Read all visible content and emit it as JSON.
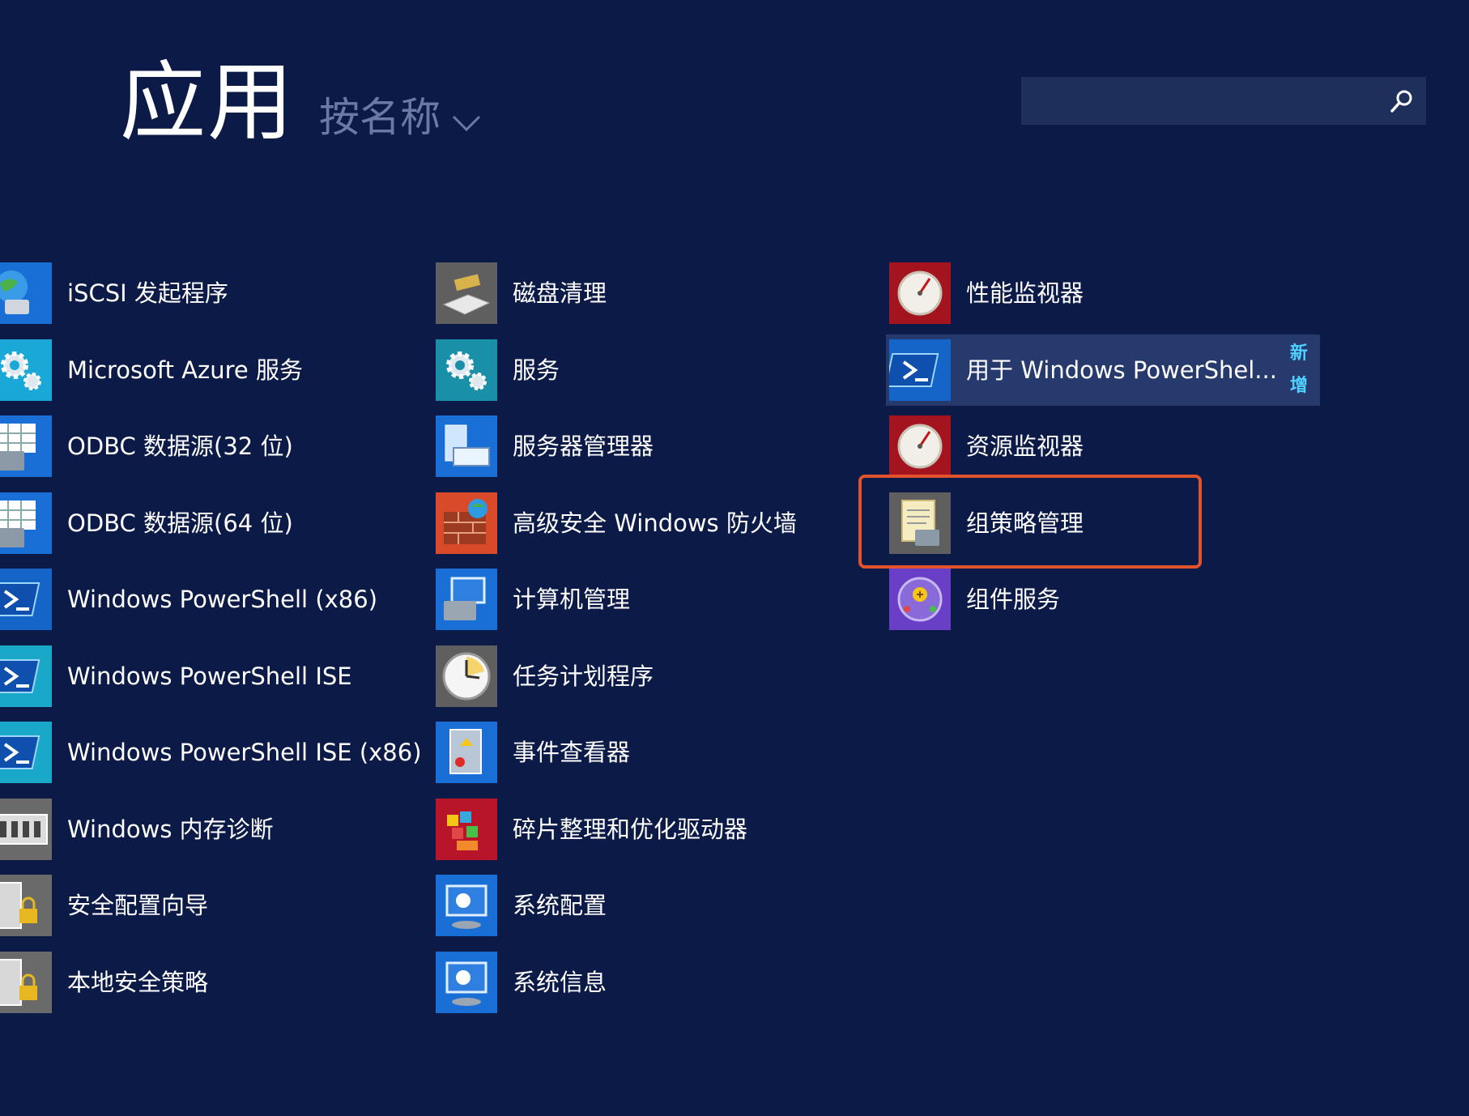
{
  "header": {
    "title": "应用",
    "sort_label": "按名称"
  },
  "search": {
    "value": "",
    "placeholder": ""
  },
  "columns": [
    {
      "items": [
        {
          "label": "iSCSI 发起程序",
          "icon": "iscsi-globe-icon",
          "color": "#1a6fd6"
        },
        {
          "label": "Microsoft Azure 服务",
          "icon": "azure-cloud-gear-icon",
          "color": "#1aa8d8"
        },
        {
          "label": "ODBC 数据源(32 位)",
          "icon": "odbc-table-toolbox-icon",
          "color": "#1a6fd6"
        },
        {
          "label": "ODBC 数据源(64 位)",
          "icon": "odbc-table-toolbox-icon",
          "color": "#1a6fd6"
        },
        {
          "label": "Windows PowerShell (x86)",
          "icon": "powershell-icon",
          "color": "#1565c8"
        },
        {
          "label": "Windows PowerShell ISE",
          "icon": "powershell-ise-icon",
          "color": "#1aa8c8"
        },
        {
          "label": "Windows PowerShell ISE (x86)",
          "icon": "powershell-ise-icon",
          "color": "#1aa8c8"
        },
        {
          "label": "Windows 内存诊断",
          "icon": "memory-chip-icon",
          "color": "#6a6a6a"
        },
        {
          "label": "安全配置向导",
          "icon": "server-lock-icon",
          "color": "#6a6a6a"
        },
        {
          "label": "本地安全策略",
          "icon": "server-lock-icon",
          "color": "#6a6a6a"
        }
      ]
    },
    {
      "items": [
        {
          "label": "磁盘清理",
          "icon": "disk-cleanup-icon",
          "color": "#5f5f5f"
        },
        {
          "label": "服务",
          "icon": "services-gears-icon",
          "color": "#1a8fa8"
        },
        {
          "label": "服务器管理器",
          "icon": "server-manager-icon",
          "color": "#1a6fd6"
        },
        {
          "label": "高级安全 Windows 防火墙",
          "icon": "firewall-brick-icon",
          "color": "#d94a2a"
        },
        {
          "label": "计算机管理",
          "icon": "computer-management-icon",
          "color": "#1a6fd6"
        },
        {
          "label": "任务计划程序",
          "icon": "clock-icon",
          "color": "#5f5f5f"
        },
        {
          "label": "事件查看器",
          "icon": "event-log-book-icon",
          "color": "#1a6fd6"
        },
        {
          "label": "碎片整理和优化驱动器",
          "icon": "defrag-blocks-icon",
          "color": "#b8142a"
        },
        {
          "label": "系统配置",
          "icon": "system-config-monitor-icon",
          "color": "#1a6fd6"
        },
        {
          "label": "系统信息",
          "icon": "system-info-monitor-icon",
          "color": "#1a6fd6"
        }
      ]
    },
    {
      "items": [
        {
          "label": "性能监视器",
          "icon": "performance-gauge-icon",
          "color": "#a3141f"
        },
        {
          "label": "用于 Windows PowerShel...",
          "icon": "powershell-icon",
          "color": "#1565c8",
          "badge": "新增",
          "selected": true
        },
        {
          "label": "资源监视器",
          "icon": "resource-gauge-icon",
          "color": "#a3141f"
        },
        {
          "label": "组策略管理",
          "icon": "group-policy-scroll-icon",
          "color": "#5f5f5f",
          "highlighted": true
        },
        {
          "label": "组件服务",
          "icon": "component-services-icon",
          "color": "#6a3fc8"
        }
      ]
    }
  ],
  "highlight_color": "#e2532c",
  "background_color": "#0b1a47"
}
